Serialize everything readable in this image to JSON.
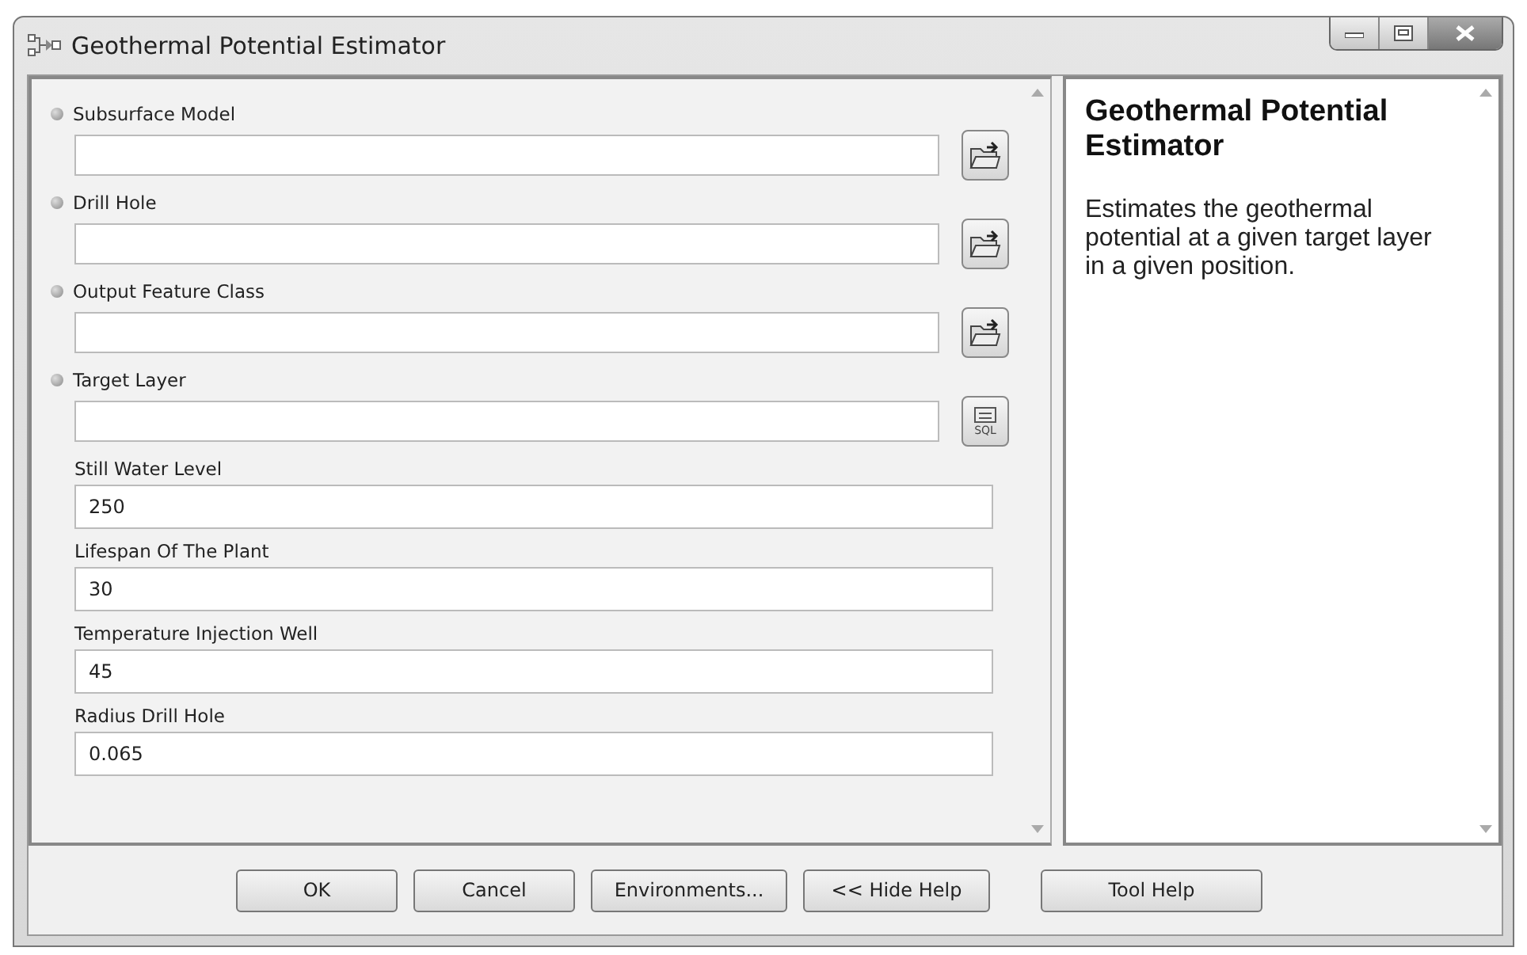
{
  "window": {
    "title": "Geothermal Potential Estimator"
  },
  "parameters": [
    {
      "kind": "folder",
      "label": "Subsurface Model"
    },
    {
      "kind": "folder",
      "label": "Drill Hole"
    },
    {
      "kind": "folder",
      "label": "Output Feature Class"
    },
    {
      "kind": "sql",
      "label": "Target Layer",
      "button_label": "SQL"
    },
    {
      "kind": "value",
      "label": "Still Water Level",
      "value": "250"
    },
    {
      "kind": "value",
      "label": "Lifespan Of The Plant",
      "value": "30"
    },
    {
      "kind": "value",
      "label": "Temperature Injection Well",
      "value": "45"
    },
    {
      "kind": "value",
      "label": "Radius Drill Hole",
      "value": "0.065"
    }
  ],
  "help": {
    "title": "Geothermal Potential Estimator",
    "text": "Estimates the geothermal potential at a given target layer in a given position."
  },
  "buttons": [
    "OK",
    "Cancel",
    "Environments...",
    "<< Hide Help",
    "Tool Help"
  ]
}
